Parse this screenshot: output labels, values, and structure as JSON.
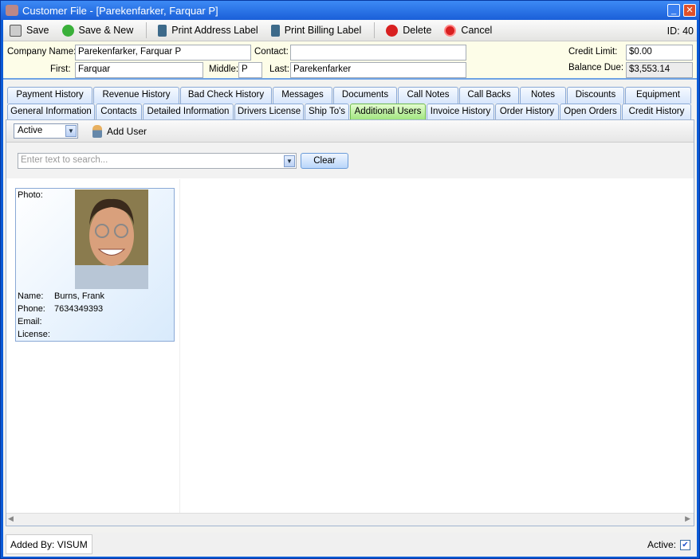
{
  "window": {
    "title": "Customer File - [Parekenfarker, Farquar P]"
  },
  "toolbar": {
    "save": "Save",
    "save_new": "Save & New",
    "print_address": "Print Address Label",
    "print_billing": "Print Billing Label",
    "delete": "Delete",
    "cancel": "Cancel",
    "id": "ID: 40"
  },
  "header": {
    "company_label": "Company Name:",
    "company": "Parekenfarker, Farquar P",
    "contact_label": "Contact:",
    "contact": "",
    "first_label": "First:",
    "first": "Farquar",
    "middle_label": "Middle:",
    "middle": "P",
    "last_label": "Last:",
    "last": "Parekenfarker",
    "credit_label": "Credit Limit:",
    "credit": "$0.00",
    "balance_label": "Balance Due:",
    "balance": "$3,553.14"
  },
  "tabs_row1": [
    "Payment History",
    "Revenue History",
    "Bad Check History",
    "Messages",
    "Documents",
    "Call Notes",
    "Call Backs",
    "Notes",
    "Discounts",
    "Equipment"
  ],
  "tabs_row2": [
    "General Information",
    "Contacts",
    "Detailed Information",
    "Drivers License",
    "Ship To's",
    "Additional Users",
    "Invoice History",
    "Order History",
    "Open Orders",
    "Credit History"
  ],
  "active_tab": "Additional Users",
  "subtoolbar": {
    "filter": "Active",
    "add_user": "Add User"
  },
  "search": {
    "placeholder": "Enter text to search...",
    "clear": "Clear"
  },
  "user_card": {
    "photo_label": "Photo:",
    "name_label": "Name:",
    "name": "Burns, Frank",
    "phone_label": "Phone:",
    "phone": "7634349393",
    "email_label": "Email:",
    "email": "",
    "license_label": "License:",
    "license": ""
  },
  "status": {
    "added_by": "Added By: VISUM",
    "active_label": "Active:",
    "active": true
  }
}
